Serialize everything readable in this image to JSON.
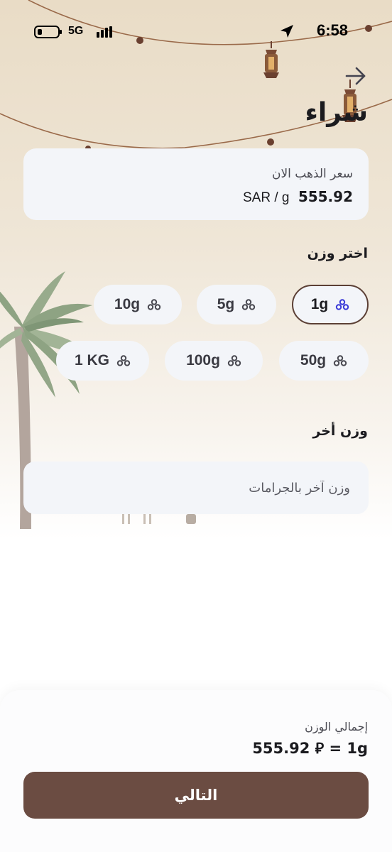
{
  "status_bar": {
    "time": "6:58",
    "network": "5G",
    "icons": [
      "battery-icon",
      "signal-icon",
      "location-arrow-icon"
    ]
  },
  "header": {
    "title": "شراء",
    "back_icon": "arrow-right-icon"
  },
  "price_card": {
    "label": "سعر الذهب الان",
    "amount": "555.92",
    "unit": "SAR / g"
  },
  "weight_section": {
    "title": "اختر وزن",
    "chip_icon": "gold-bars-icon",
    "options": [
      {
        "label": "1g",
        "selected": true
      },
      {
        "label": "5g",
        "selected": false
      },
      {
        "label": "10g",
        "selected": false
      },
      {
        "label": "50g",
        "selected": false
      },
      {
        "label": "100g",
        "selected": false
      },
      {
        "label": "1 KG",
        "selected": false
      }
    ]
  },
  "custom_weight": {
    "title": "وزن أخر",
    "placeholder": "وزن آخر بالجرامات",
    "value": ""
  },
  "summary": {
    "label": "إجمالي الوزن",
    "value": "555.92 ⃁ = 1g"
  },
  "next_button": {
    "label": "التالي"
  },
  "colors": {
    "background_top": "#e9dcc6",
    "card": "#f3f5f9",
    "accent_brown": "#6b4c42",
    "selected_border": "#5c4036",
    "chip_icon_selected": "#3b3bd8",
    "chip_icon": "#4a4a52"
  }
}
